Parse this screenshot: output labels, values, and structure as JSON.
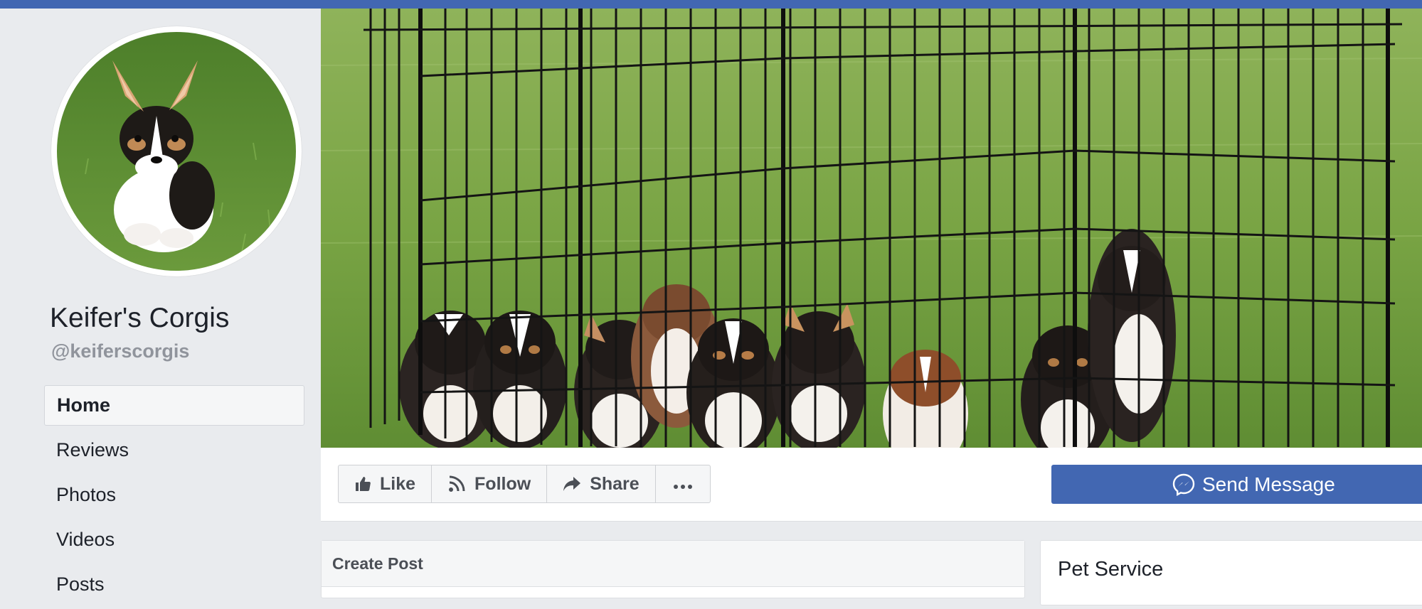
{
  "colors": {
    "brand_blue": "#4267b2",
    "page_bg": "#e9ebee",
    "muted_text": "#90949c"
  },
  "page": {
    "name": "Keifer's Corgis",
    "handle": "@keiferscorgis"
  },
  "nav": {
    "items": [
      {
        "label": "Home",
        "active": true
      },
      {
        "label": "Reviews"
      },
      {
        "label": "Photos"
      },
      {
        "label": "Videos"
      },
      {
        "label": "Posts"
      }
    ]
  },
  "actions": {
    "like": {
      "label": "Like",
      "icon": "thumbs-up-icon"
    },
    "follow": {
      "label": "Follow",
      "icon": "rss-feed-icon"
    },
    "share": {
      "label": "Share",
      "icon": "share-arrow-icon"
    },
    "more": {
      "icon": "ellipsis-icon"
    },
    "send_message": {
      "label": "Send Message",
      "icon": "messenger-icon"
    }
  },
  "create_post": {
    "title": "Create Post"
  },
  "about_card": {
    "category": "Pet Service"
  }
}
